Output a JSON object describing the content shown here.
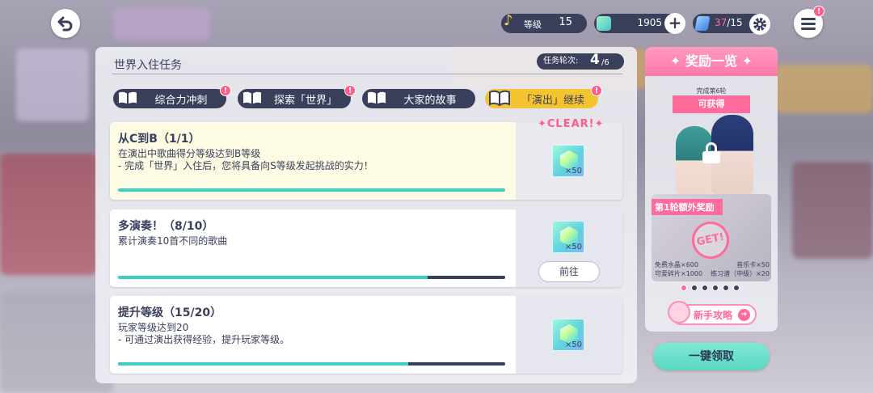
{
  "header": {
    "level_label": "等级",
    "level_value": "15",
    "gems": "1905",
    "stamina_current": "37",
    "stamina_max": "/15",
    "menu_badge": "!"
  },
  "mission_panel": {
    "title": "世界入住任务",
    "round_label": "任务轮次:",
    "round_current": "4",
    "round_max": "/6",
    "tabs": [
      {
        "label": "综合力冲刺",
        "badge": "!"
      },
      {
        "label": "探索「世界」",
        "badge": "!"
      },
      {
        "label": "大家的故事",
        "badge": ""
      },
      {
        "label": "「演出」继续",
        "badge": "!"
      }
    ],
    "missions": [
      {
        "title": "从C到B（1/1）",
        "desc_line1": "在演出中歌曲得分等级达到B等级",
        "desc_line2": "- 完成「世界」入住后，您将具备向S等级发起挑战的实力！",
        "progress": 1.0,
        "reward_qty": "×50",
        "status": "✦CLEAR!✦"
      },
      {
        "title": "多演奏！（8/10）",
        "desc_line1": "累计演奏10首不同的歌曲",
        "desc_line2": "",
        "progress": 0.8,
        "reward_qty": "×50",
        "action_label": "前往"
      },
      {
        "title": "提升等级（15/20）",
        "desc_line1": "玩家等级达到20",
        "desc_line2": "- 可通过演出获得经验，提升玩家等级。",
        "progress": 0.75,
        "reward_qty": "×50"
      }
    ]
  },
  "reward_panel": {
    "title": "✦ 奖励一览 ✦",
    "ribbon_top": "完成第6轮",
    "ribbon_text": "可获得",
    "bonus_tag": "第1轮额外奖励",
    "get_stamp": "GET!",
    "bonus_items": [
      [
        "免费水晶×600",
        "音乐卡×50"
      ],
      [
        "可爱碎片×1000",
        "练习谱（中级）×20"
      ]
    ],
    "page_count": 6,
    "active_page": 0,
    "guide_label": "新手攻略",
    "claim_all_label": "一键领取"
  },
  "colors": {
    "navy": "#3a3f5c",
    "accent_pink": "#ff6b9d",
    "accent_yellow": "#f4c430",
    "progress_teal": "#3ccfc6",
    "claim_teal": "#5ad6c2"
  }
}
